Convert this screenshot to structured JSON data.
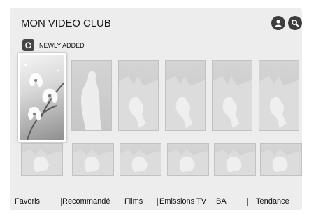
{
  "header": {
    "title": "MON VIDEO CLUB"
  },
  "icons": {
    "profile": "user-icon",
    "search": "search-icon",
    "refresh": "refresh-icon"
  },
  "section": {
    "label": "NEWLY ADDED"
  },
  "menu": [
    {
      "label": "Favoris"
    },
    {
      "label": "Recommandé"
    },
    {
      "label": "Films"
    },
    {
      "label": "Emissions TV"
    },
    {
      "label": "BA"
    },
    {
      "label": "Tendance"
    }
  ],
  "colors": {
    "background": "#ededed",
    "focus": "#ffffff",
    "icon": "#3c3c3c"
  }
}
